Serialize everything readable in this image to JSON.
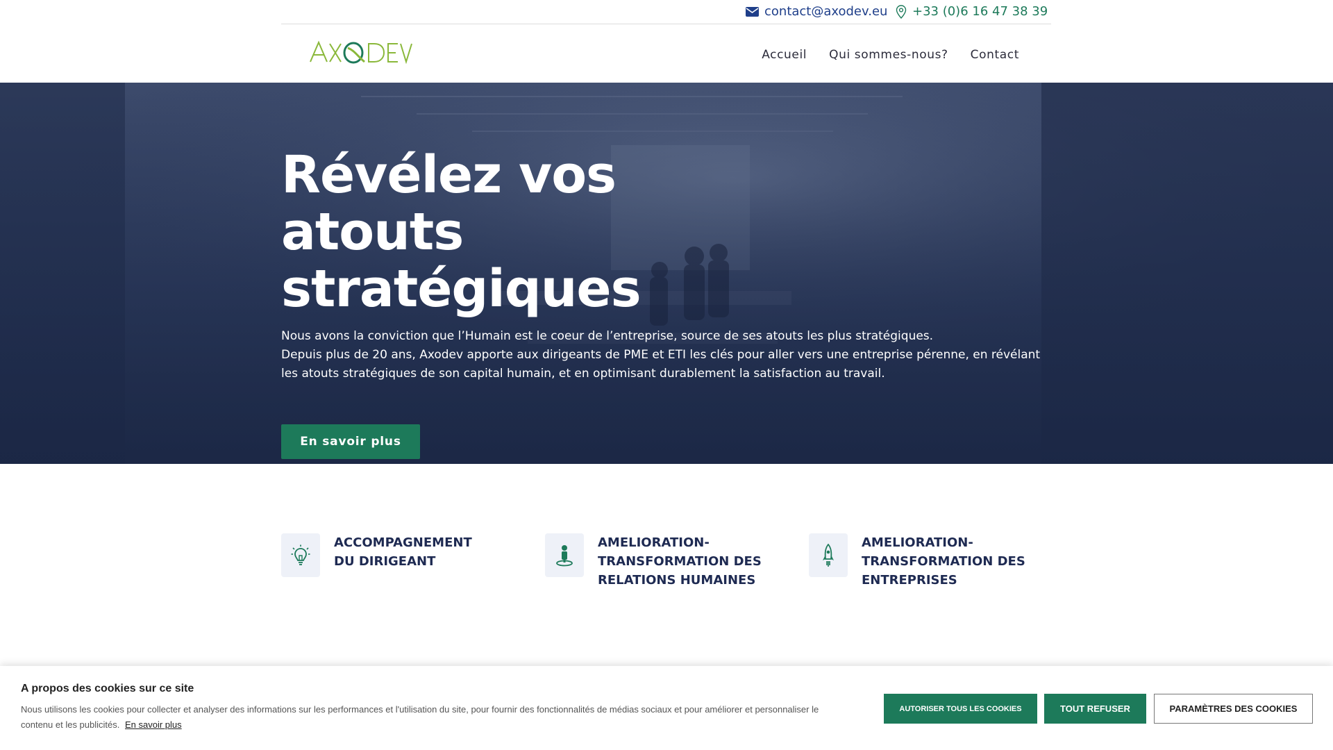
{
  "topbar": {
    "email": "contact@axodev.eu",
    "phone": "+33 (0)6 16 47 38 39"
  },
  "header": {
    "logo_text": "AXODEV",
    "nav": [
      "Accueil",
      "Qui sommes-nous?",
      "Contact"
    ]
  },
  "hero": {
    "title_line1": "Révélez vos atouts",
    "title_line2": "stratégiques",
    "paragraph1": "Nous avons la conviction que l’Humain est le coeur de l’entreprise, source de ses atouts les plus stratégiques.",
    "paragraph2": "Depuis plus de 20 ans, Axodev apporte aux dirigeants de PME et ETI les clés pour aller vers une entreprise pérenne, en révélant les atouts stratégiques de son capital humain, et en optimisant durablement la satisfaction au travail.",
    "button": "En savoir plus"
  },
  "features": [
    {
      "icon": "lightbulb-icon",
      "line1": "ACCOMPAGNEMENT",
      "line2": "DU DIRIGEANT",
      "line3": ""
    },
    {
      "icon": "person-pin-icon",
      "line1": "AMELIORATION-",
      "line2": "TRANSFORMATION DES",
      "line3": "RELATIONS HUMAINES"
    },
    {
      "icon": "rocket-icon",
      "line1": "AMELIORATION-",
      "line2": "TRANSFORMATION DES",
      "line3": "ENTREPRISES"
    }
  ],
  "cookie": {
    "title": "A propos des cookies sur ce site",
    "text": "Nous utilisons les cookies pour collecter et analyser des informations sur les performances et l'utilisation du site, pour fournir des fonctionnalités de médias sociaux et pour améliorer et personnaliser le contenu et les publicités.",
    "link": "En savoir plus",
    "allow": "AUTORISER TOUS LES COOKIES",
    "refuse": "TOUT REFUSER",
    "params": "PARAMÈTRES DES COOKIES"
  },
  "colors": {
    "accent_green": "#1d7a5a",
    "navy": "#1e2a52",
    "logo_green": "#8ab83a"
  }
}
